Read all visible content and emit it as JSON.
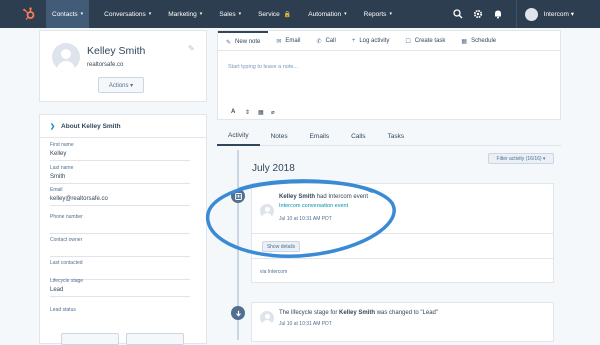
{
  "colors": {
    "nav_bg": "#2d3e50",
    "accent": "#0091ae",
    "annotation": "#3a8ad6",
    "logo": "#ff7a59"
  },
  "topnav": {
    "logo_icon": "hubspot-logo",
    "items": [
      {
        "label": "Contacts",
        "chev": "▾"
      },
      {
        "label": "Conversations",
        "chev": "▾"
      },
      {
        "label": "Marketing",
        "chev": "▾"
      },
      {
        "label": "Sales",
        "chev": "▾"
      },
      {
        "label": "Service",
        "chev": ""
      },
      {
        "label": "Automation",
        "chev": "▾"
      },
      {
        "label": "Reports",
        "chev": "▾"
      }
    ],
    "right_icons": [
      "search-icon",
      "gear-icon",
      "bell-icon"
    ],
    "account": "Intercom ▾"
  },
  "profile": {
    "name": "Kelley Smith",
    "domain": "realtorsafe.co",
    "actions_label": "Actions ▾"
  },
  "about": {
    "heading": "About Kelley Smith",
    "fields": [
      {
        "label": "First name",
        "value": "Kelley"
      },
      {
        "label": "Last name",
        "value": "Smith"
      },
      {
        "label": "Email",
        "value": "kelley@realtorsafe.co"
      },
      {
        "label": "Phone number",
        "value": ""
      },
      {
        "label": "Contact owner",
        "value": ""
      },
      {
        "label": "Last contacted",
        "value": ""
      },
      {
        "label": "Lifecycle stage",
        "value": "Lead"
      },
      {
        "label": "Lead status",
        "value": ""
      }
    ]
  },
  "compose": {
    "tabs": [
      {
        "label": "New note",
        "icon": "✎"
      },
      {
        "label": "Email",
        "icon": "✉"
      },
      {
        "label": "Call",
        "icon": "✆"
      },
      {
        "label": "Log activity",
        "icon": "+"
      },
      {
        "label": "Create task",
        "icon": "☐"
      },
      {
        "label": "Schedule",
        "icon": "▦"
      }
    ],
    "placeholder": "Start typing to leave a note...",
    "format_tools": [
      "A",
      "⇕",
      "▦",
      "⌀"
    ]
  },
  "activity_tabs": [
    "Activity",
    "Notes",
    "Emails",
    "Calls",
    "Tasks"
  ],
  "timeline": {
    "month": "July 2018",
    "filter_label": "Filter activity (16/16) ▾",
    "event1": {
      "actor": "Kelley Smith",
      "action": " had Intercom event",
      "link": "Intercom conversation event",
      "time": "Jul 10 at 10:31 AM PDT",
      "button": "Show details",
      "via": "via Intercom"
    },
    "event2": {
      "prefix": "The lifecycle stage for ",
      "actor": "Kelley Smith",
      "suffix": " was changed to \"Lead\"",
      "time": "Jul 10 at 10:31 AM PDT"
    }
  }
}
